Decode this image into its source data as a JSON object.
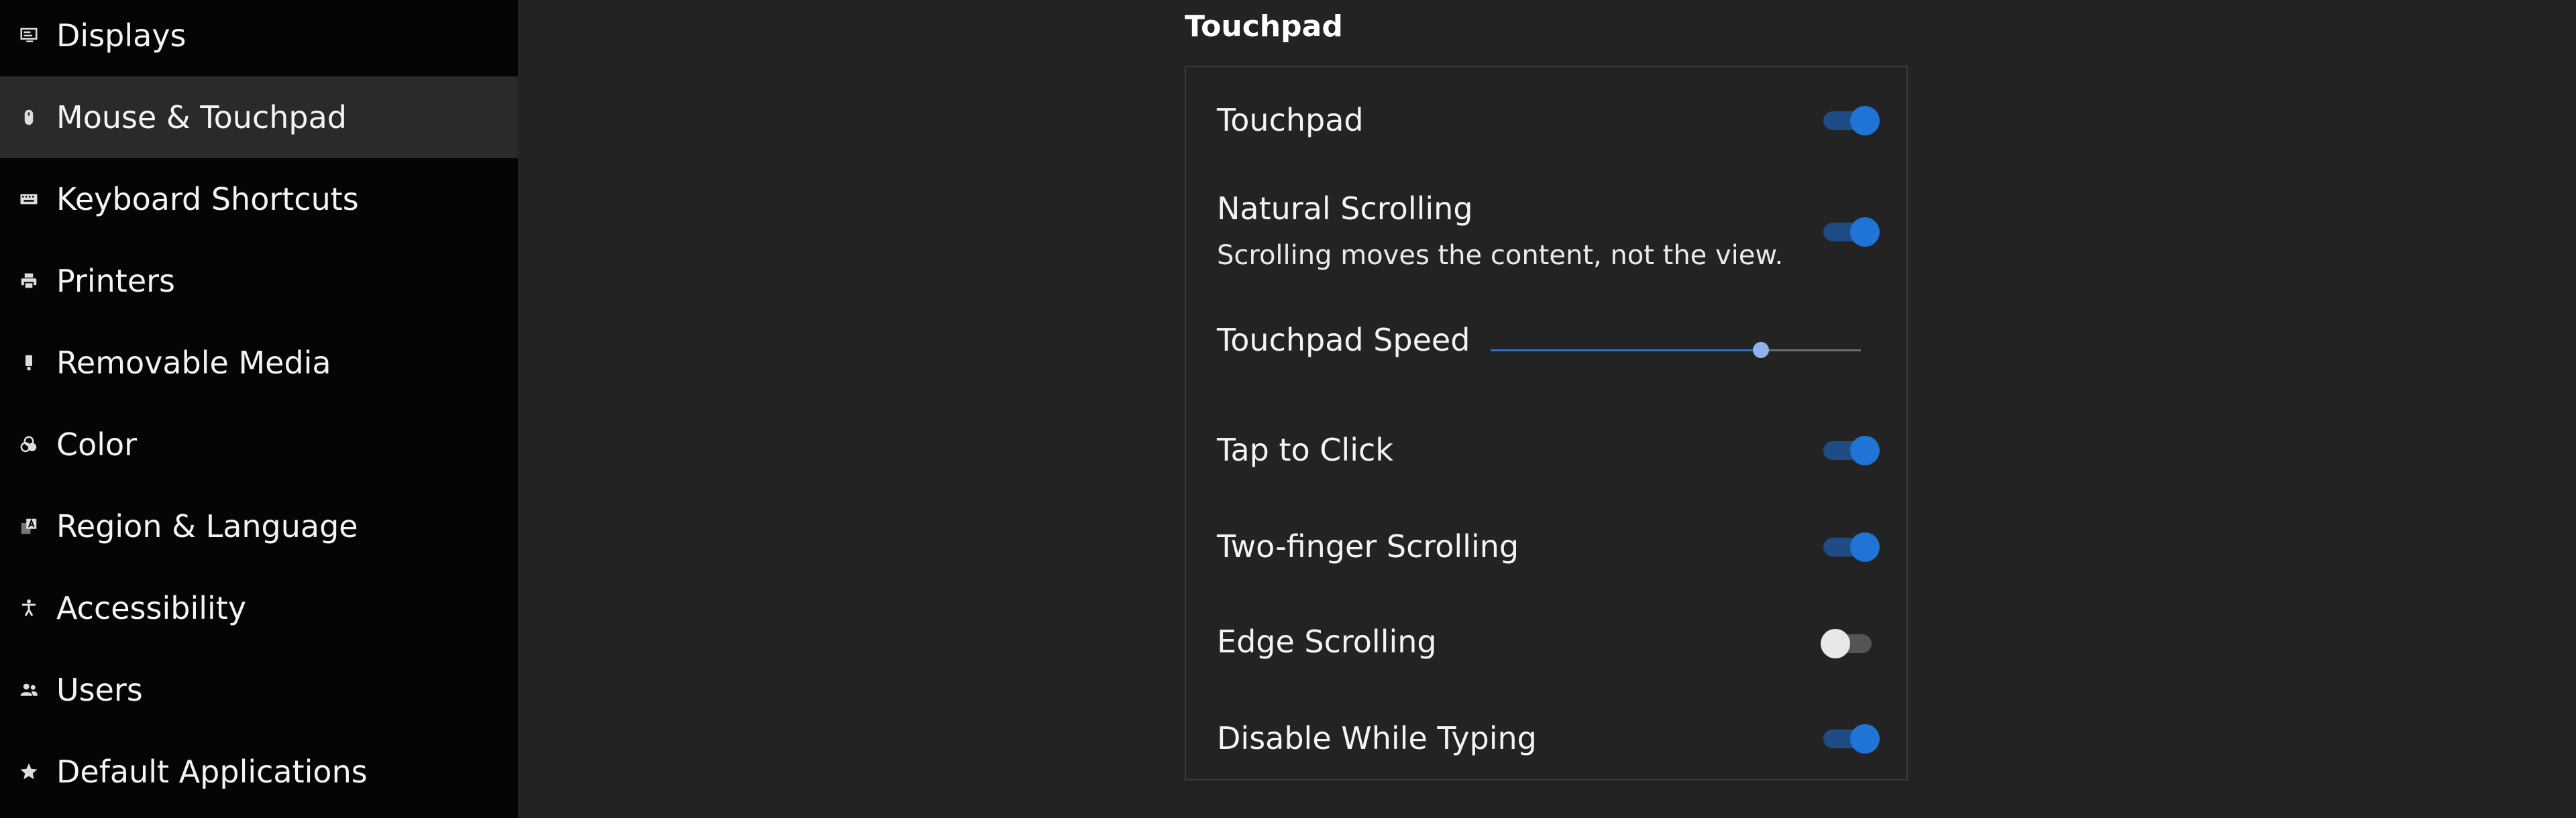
{
  "sidebar": {
    "items": [
      {
        "label": "Displays",
        "icon": "display-icon",
        "active": false
      },
      {
        "label": "Mouse & Touchpad",
        "icon": "mouse-icon",
        "active": true
      },
      {
        "label": "Keyboard Shortcuts",
        "icon": "keyboard-icon",
        "active": false
      },
      {
        "label": "Printers",
        "icon": "printer-icon",
        "active": false
      },
      {
        "label": "Removable Media",
        "icon": "usb-drive-icon",
        "active": false
      },
      {
        "label": "Color",
        "icon": "color-icon",
        "active": false
      },
      {
        "label": "Region & Language",
        "icon": "language-icon",
        "active": false
      },
      {
        "label": "Accessibility",
        "icon": "accessibility-icon",
        "active": false
      },
      {
        "label": "Users",
        "icon": "users-icon",
        "active": false
      },
      {
        "label": "Default Applications",
        "icon": "star-icon",
        "active": false
      }
    ]
  },
  "section": {
    "title": "Touchpad"
  },
  "settings": {
    "touchpad": {
      "label": "Touchpad",
      "enabled": true
    },
    "natural_scrolling": {
      "label": "Natural Scrolling",
      "description": "Scrolling moves the content, not the view.",
      "enabled": true
    },
    "touchpad_speed": {
      "label": "Touchpad Speed",
      "value_fraction": 0.73
    },
    "tap_to_click": {
      "label": "Tap to Click",
      "enabled": true
    },
    "two_finger_scrolling": {
      "label": "Two-finger Scrolling",
      "enabled": true
    },
    "edge_scrolling": {
      "label": "Edge Scrolling",
      "enabled": false
    },
    "disable_while_typing": {
      "label": "Disable While Typing",
      "enabled": true
    }
  },
  "colors": {
    "accent": "#1f74d6",
    "sidebar_bg": "#050505",
    "content_bg": "#232323"
  }
}
